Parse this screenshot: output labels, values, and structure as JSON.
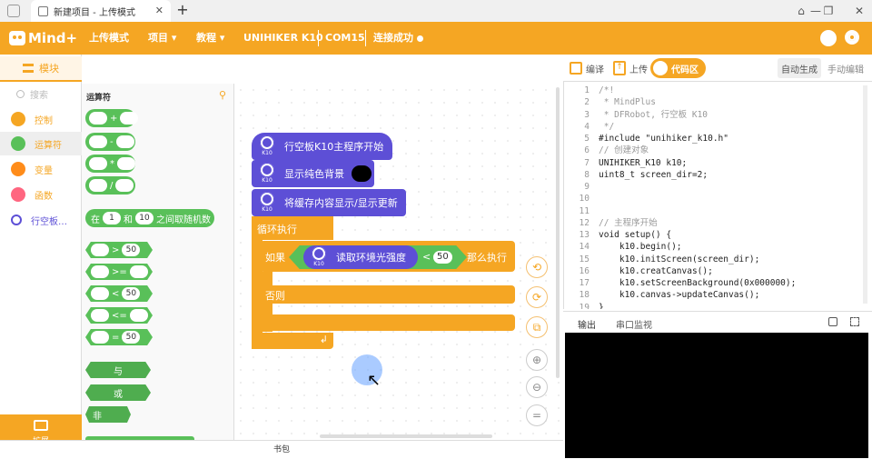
{
  "browser": {
    "tab_title": "新建项目 - 上传模式",
    "close_glyph": "✕",
    "new_tab_glyph": "+",
    "win_controls": [
      "⌂",
      "—",
      "❐",
      "✕"
    ]
  },
  "menubar": {
    "logo_text": "Mind+",
    "items": [
      "上传模式",
      "项目 ▾",
      "教程 ▾",
      "UNIHIKER K10",
      "COM15",
      "连接成功"
    ],
    "right_icons": [
      "robot-icon",
      "gear-icon"
    ]
  },
  "left_panel": {
    "tab_label": "模块",
    "search_placeholder": "搜索",
    "categories": [
      {
        "label": "控制",
        "color": "#f5a623"
      },
      {
        "label": "运算符",
        "color": "#59c059"
      },
      {
        "label": "变量",
        "color": "#ff8c1a"
      },
      {
        "label": "函数",
        "color": "#ff6680"
      },
      {
        "label": "行空板…",
        "color": "#5d4fd6"
      }
    ],
    "extension_label": "扩展"
  },
  "flyout": {
    "header": "运算符",
    "arith_ops": [
      "+",
      "-",
      "*",
      "/"
    ],
    "random_block": {
      "prefix": "在",
      "min": "1",
      "mid": "和",
      "max": "10",
      "suffix": "之间取随机数"
    },
    "compare_ops": [
      {
        "op": ">",
        "value": "50"
      },
      {
        "op": ">=",
        "value": ""
      },
      {
        "op": "<",
        "value": "50"
      },
      {
        "op": "<=",
        "value": ""
      },
      {
        "op": "=",
        "value": "50"
      }
    ],
    "logic_ops": [
      "与",
      "或",
      "非"
    ]
  },
  "workspace": {
    "blocks": [
      {
        "label": "行空板K10主程序开始",
        "icon_caption": "K10"
      },
      {
        "label": "显示纯色背景",
        "icon_caption": "K10"
      },
      {
        "label": "将缓存内容显示/显示更新",
        "icon_caption": "K10"
      }
    ],
    "loop_label": "循环执行",
    "if_label": "如果",
    "sensor_label": "读取环境光强度",
    "compare_op": "<",
    "compare_value": "50",
    "then_label": "那么执行",
    "else_label": "否则",
    "loop_arrow": "↲",
    "side_controls": [
      "⟲",
      "⟳",
      "⧉",
      "⊕",
      "⊖",
      "="
    ]
  },
  "book_bar": "书包",
  "right_panel": {
    "compile_label": "编译",
    "upload_label": "上传",
    "code_tab": "代码区",
    "auto_label": "自动生成",
    "manual_label": "手动编辑",
    "code_lines": [
      {
        "n": "1",
        "t": "/*!"
      },
      {
        "n": "2",
        "t": " * MindPlus"
      },
      {
        "n": "3",
        "t": " * DFRobot, 行空板 K10"
      },
      {
        "n": "4",
        "t": " */"
      },
      {
        "n": "5",
        "t": "#include \"unihiker_k10.h\""
      },
      {
        "n": "6",
        "t": "// 创建对象"
      },
      {
        "n": "7",
        "t": "UNIHIKER_K10 k10;"
      },
      {
        "n": "8",
        "t": "uint8_t screen_dir=2;"
      },
      {
        "n": "9",
        "t": ""
      },
      {
        "n": "10",
        "t": ""
      },
      {
        "n": "11",
        "t": ""
      },
      {
        "n": "12",
        "t": "// 主程序开始"
      },
      {
        "n": "13",
        "t": "void setup() {"
      },
      {
        "n": "14",
        "t": "    k10.begin();"
      },
      {
        "n": "15",
        "t": "    k10.initScreen(screen_dir);"
      },
      {
        "n": "16",
        "t": "    k10.creatCanvas();"
      },
      {
        "n": "17",
        "t": "    k10.setScreenBackground(0x000000);"
      },
      {
        "n": "18",
        "t": "    k10.canvas->updateCanvas();"
      },
      {
        "n": "19",
        "t": "}"
      }
    ],
    "output_tab": "输出",
    "serial_tab": "串口监视"
  },
  "colors": {
    "brand": "#f5a623",
    "operators": "#59c059",
    "k10_blocks": "#5d4fd6",
    "code_comment": "#999999",
    "code_keyword": "#0000cc"
  }
}
